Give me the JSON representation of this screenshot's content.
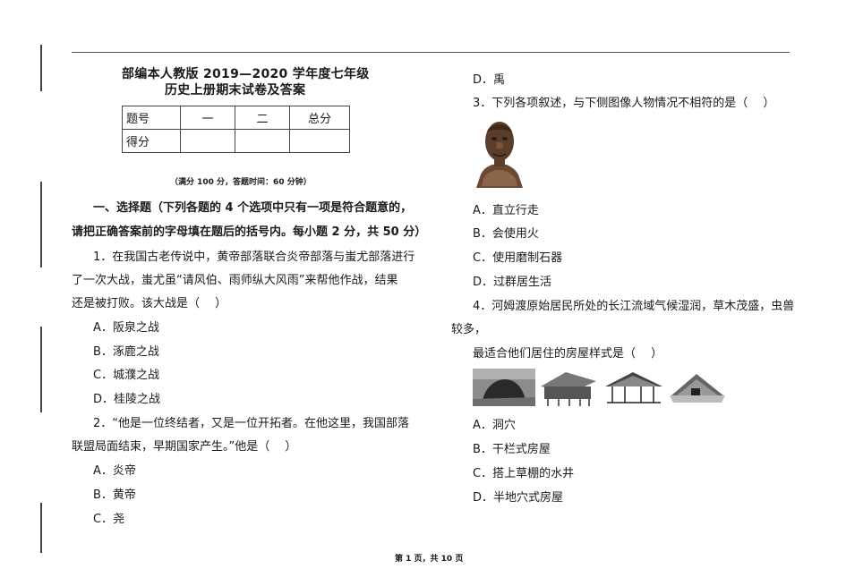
{
  "header": {
    "title_line1": "部编本人教版 2019—2020 学年度七年级",
    "title_line2": "历史上册期末试卷及答案"
  },
  "score_table": {
    "row1": [
      "题号",
      "一",
      "二",
      "总分"
    ],
    "row2": [
      "得分",
      "",
      "",
      ""
    ]
  },
  "exam_note": "（满分 100 分，答题时间：60 分钟）",
  "section1": {
    "heading_line1": "一、选择题（下列各题的 4 个选项中只有一项是符合题意的，",
    "heading_line2": "请把正确答案前的字母填在题后的括号内。每小题 2 分，共 50 分）"
  },
  "q1": {
    "lines": [
      "1．在我国古老传说中，黄帝部落联合炎帝部落与蚩尤部落进行",
      "了一次大战，蚩尤虽“请风伯、雨师纵大风雨”来帮他作战，结果",
      "还是被打败。该大战是（　  ）"
    ],
    "options": [
      "A．阪泉之战",
      "B．涿鹿之战",
      "C．城濮之战",
      "D．桂陵之战"
    ]
  },
  "q2": {
    "lines": [
      "2．“他是一位终结者，又是一位开拓者。在他这里，我国部落",
      "联盟局面结束，早期国家产生。”他是（　  ）"
    ],
    "options": [
      "A．炎帝",
      "B．黄帝",
      "C．尧",
      "D．禹"
    ]
  },
  "q3": {
    "line": "3．下列各项叙述，与下侧图像人物情况不相符的是（　  ）",
    "options": [
      "A．直立行走",
      "B．会使用火",
      "C．使用磨制石器",
      "D．过群居生活"
    ]
  },
  "q4": {
    "lines": [
      "4．河姆渡原始居民所处的长江流域气候湿润，草木茂盛，虫兽",
      "较多，",
      "最适合他们居住的房屋样式是（　  ）"
    ],
    "options": [
      "A．洞穴",
      "B．干栏式房屋",
      "C．搭上草棚的水井",
      "D．半地穴式房屋"
    ]
  },
  "footer": "第 1 页，共 10 页"
}
